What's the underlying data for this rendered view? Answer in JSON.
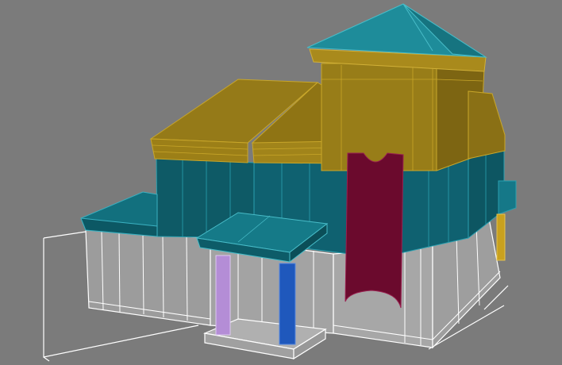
{
  "viewport": {
    "background_color": "#7b7b7b",
    "wireframe_color": "#ffffff"
  },
  "materials": {
    "roof_yellow": "#8f7516",
    "roof_yellow_dark": "#6f5a10",
    "roof_yellow_light": "#a98a1c",
    "teal": "#0f5f6c",
    "teal_light": "#157888",
    "teal_roof": "#1b8a98",
    "white_base": "#9b9b9b",
    "banner_maroon": "#6a0b2c",
    "column_lilac": "#b58fd7",
    "column_blue": "#1d55b8",
    "post_yellow": "#c9a11e"
  }
}
